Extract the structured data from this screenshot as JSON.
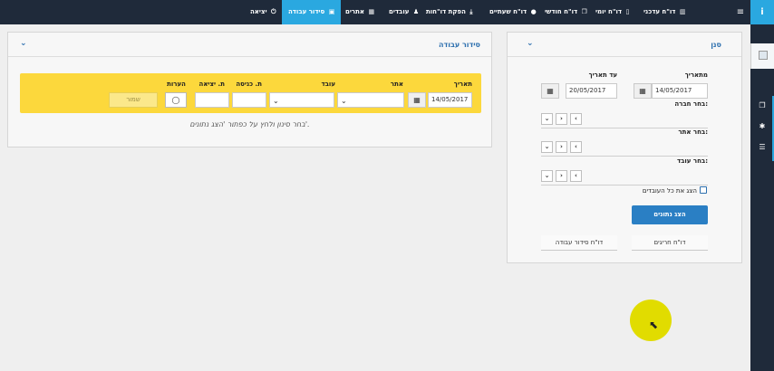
{
  "nav": {
    "items": [
      {
        "label": "דו\"ח עדכני",
        "icon": "chart-icon"
      },
      {
        "label": "דו\"ח יומי",
        "icon": "document-icon"
      },
      {
        "label": "דו\"ח חודשי",
        "icon": "copy-icon"
      },
      {
        "label": "דו\"ח שעתיים",
        "icon": "info-icon"
      },
      {
        "label": "הפקת דו\"חות",
        "icon": "download-icon"
      },
      {
        "label": "עובדים",
        "icon": "person-icon"
      },
      {
        "label": "אתרים",
        "icon": "map-icon"
      },
      {
        "label": "סידור עבודה",
        "icon": "calendar-icon"
      },
      {
        "label": "יציאה",
        "icon": "power-icon"
      }
    ],
    "active": "סידור עבודה"
  },
  "schedule_panel": {
    "title": "סידור עבודה",
    "filter": {
      "date_label": "תאריך",
      "date_value": "14/05/2017",
      "site_label": "אתר",
      "employee_label": "עובד",
      "entry_label": "ת. כניסה",
      "exit_label": "ת. יציאה",
      "notes_label": "הערות",
      "save_label": "שמור"
    },
    "hint": "בחר סינון ולחץ על כפתור 'הצג נתונים'."
  },
  "filter_panel": {
    "title": "סנן",
    "from_date_label": "מתאריך",
    "from_date_value": "14/05/2017",
    "to_date_label": "עד תאריך",
    "to_date_value": "20/05/2017",
    "company_label": "בחר חברה:",
    "site_label": "בחר אתר:",
    "employee_label": "בחר עובד:",
    "show_all_label": "הצג את כל העובדים",
    "show_data_label": "הצג נתונים",
    "exceptions_report_label": "דו\"ח חריגים",
    "schedule_report_label": "דו\"ח סידור עבודה"
  },
  "colors": {
    "topbar": "#1f2a3a",
    "accent": "#2aa8e0",
    "filter_bar": "#fcd83c",
    "primary_button": "#2a7fc4"
  }
}
